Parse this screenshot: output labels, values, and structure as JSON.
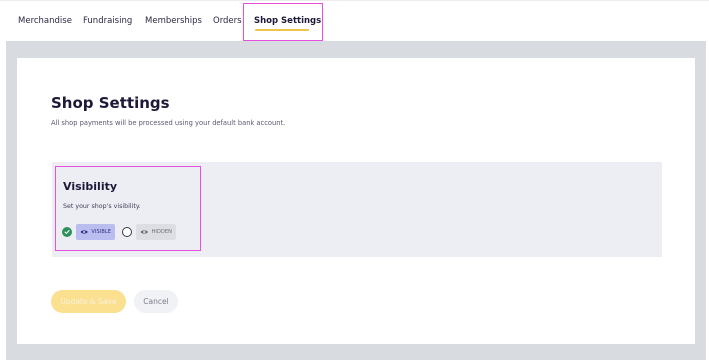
{
  "nav": {
    "tabs": [
      {
        "label": "Merchandise"
      },
      {
        "label": "Fundraising"
      },
      {
        "label": "Memberships"
      },
      {
        "label": "Orders"
      },
      {
        "label": "Shop Settings",
        "active": true
      }
    ]
  },
  "page": {
    "title": "Shop Settings",
    "subtitle": "All shop payments will be processed using your default bank account."
  },
  "visibility": {
    "title": "Visibility",
    "description": "Set your shop's visibility.",
    "options": [
      {
        "label": "VISIBLE",
        "icon": "eye-icon",
        "selected": true
      },
      {
        "label": "HIDDEN",
        "icon": "eye-icon",
        "selected": false
      }
    ]
  },
  "actions": {
    "update_label": "Update & Save",
    "cancel_label": "Cancel"
  },
  "colors": {
    "accent": "#f0c44c",
    "highlight": "#e64fe0",
    "selected_radio": "#2f8f5b",
    "visible_chip": "#b9bdf0"
  }
}
